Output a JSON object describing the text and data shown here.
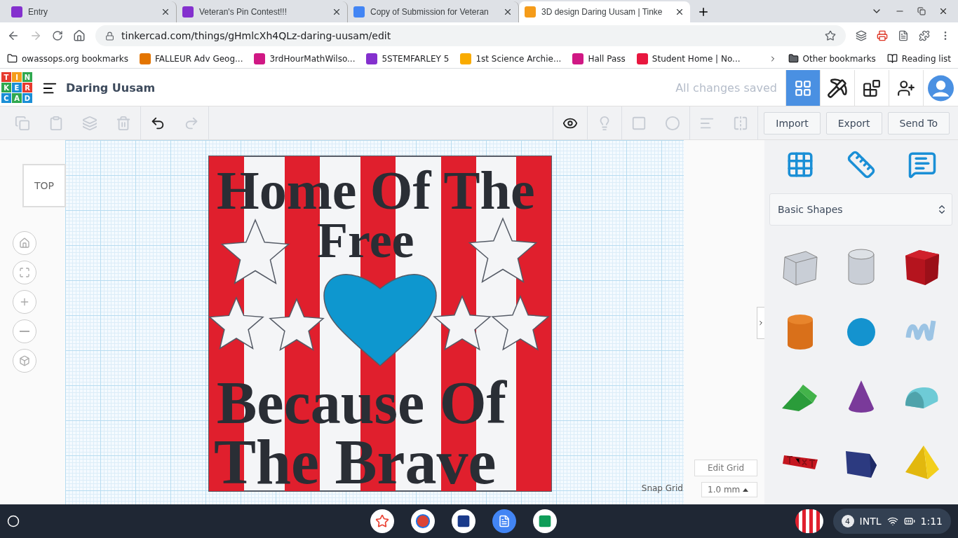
{
  "browser": {
    "tabs": [
      {
        "title": "Entry",
        "kind": "classroom",
        "selected": false
      },
      {
        "title": "Veteran's Pin Contest!!!",
        "kind": "classroom",
        "selected": false
      },
      {
        "title": "Copy of Submission for Veteran",
        "kind": "docs",
        "selected": false
      },
      {
        "title": "3D design Daring Uusam | Tinke",
        "kind": "tinkercad",
        "selected": true
      }
    ],
    "url": "tinkercad.com/things/gHmlcXh4QLz-daring-uusam/edit",
    "bookmarks": [
      {
        "label": "owassops.org bookmarks",
        "kind": "folder"
      },
      {
        "label": "FALLEUR Adv Geog...",
        "kind": "class",
        "color": "#e37400"
      },
      {
        "label": "3rdHourMathWilso...",
        "kind": "class",
        "color": "#d01884"
      },
      {
        "label": "5STEMFARLEY 5",
        "kind": "class",
        "color": "#8430ce"
      },
      {
        "label": "1st Science Archie...",
        "kind": "class",
        "color": "#f9ab00"
      },
      {
        "label": "Hall Pass",
        "kind": "class",
        "color": "#d01884"
      },
      {
        "label": "Student Home | No...",
        "kind": "n",
        "color": "#e8173f"
      }
    ],
    "other_bookmarks": "Other bookmarks",
    "reading_list": "Reading list"
  },
  "app": {
    "logo": [
      "T",
      "I",
      "N",
      "K",
      "E",
      "R",
      "C",
      "A",
      "D"
    ],
    "title": "Daring Uusam",
    "save_status": "All changes saved",
    "modes": [
      {
        "kind": "grid",
        "selected": true
      },
      {
        "kind": "pickaxe",
        "selected": false
      },
      {
        "kind": "bricks",
        "selected": false
      }
    ],
    "actions": [
      "Import",
      "Export",
      "Send To"
    ],
    "view_cube": "TOP",
    "design": {
      "lines": [
        "Home Of The",
        "Free",
        "Because Of",
        "The Brave"
      ]
    },
    "edit_grid": "Edit Grid",
    "snap_grid_label": "Snap Grid",
    "snap_grid_value": "1.0 mm",
    "library": "Basic Shapes",
    "shapes": [
      {
        "kind": "box-hole"
      },
      {
        "kind": "cylinder-hole"
      },
      {
        "kind": "box"
      },
      {
        "kind": "cylinder"
      },
      {
        "kind": "sphere"
      },
      {
        "kind": "scribble"
      },
      {
        "kind": "roof"
      },
      {
        "kind": "cone"
      },
      {
        "kind": "round-roof"
      },
      {
        "kind": "text"
      },
      {
        "kind": "polygon"
      },
      {
        "kind": "pyramid"
      }
    ]
  },
  "taskbar": {
    "apps": [
      {
        "kind": "photos"
      },
      {
        "kind": "chrome"
      },
      {
        "kind": "class"
      },
      {
        "kind": "docs"
      },
      {
        "kind": "classroom"
      }
    ],
    "notifications": "4",
    "keyboard": "INTL",
    "time": "1:11"
  }
}
